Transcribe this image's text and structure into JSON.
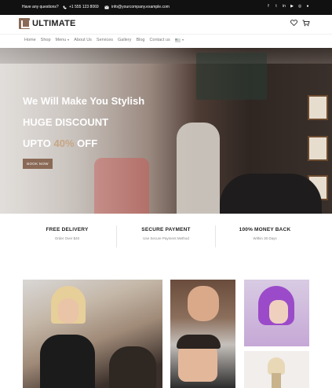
{
  "topbar": {
    "question": "Have any questions?",
    "phone": "+1 555 123 8069",
    "email": "info@yourcompany.example.com",
    "social_icons": [
      "facebook-icon",
      "twitter-icon",
      "linkedin-icon",
      "youtube-icon",
      "instagram-icon",
      "github-icon"
    ]
  },
  "header": {
    "logo_text": "ULTIMATE",
    "icons": [
      "heart-icon",
      "cart-icon"
    ]
  },
  "nav": {
    "items": [
      {
        "label": "Home"
      },
      {
        "label": "Shop"
      },
      {
        "label": "Menu"
      },
      {
        "label": "About Us"
      },
      {
        "label": "Services"
      },
      {
        "label": "Gallery"
      },
      {
        "label": "Blog"
      },
      {
        "label": "Contact us"
      }
    ]
  },
  "hero": {
    "line1": "We Will Make You Stylish",
    "line2": "HUGE DISCOUNT",
    "line3_pre": "UPTO ",
    "line3_pct": "40%",
    "line3_post": " OFF",
    "button": "BOOK NOW",
    "accent_color": "#8a6a56"
  },
  "features": [
    {
      "title": "FREE DELIVERY",
      "subtitle": "Order Over $40"
    },
    {
      "title": "SECURE PAYMENT",
      "subtitle": "Use Secure Payment Method"
    },
    {
      "title": "100% MONEY BACK",
      "subtitle": "Within 30 Days"
    }
  ]
}
